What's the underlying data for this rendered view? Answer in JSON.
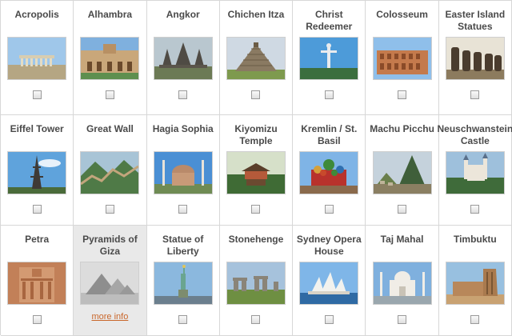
{
  "wonders": [
    {
      "name": "Acropolis",
      "thumb": "acropolis-photo"
    },
    {
      "name": "Alhambra",
      "thumb": "alhambra-photo"
    },
    {
      "name": "Angkor",
      "thumb": "angkor-photo"
    },
    {
      "name": "Chichen Itza",
      "thumb": "chichen-itza-photo"
    },
    {
      "name": "Christ Redeemer",
      "thumb": "christ-redeemer-photo"
    },
    {
      "name": "Colosseum",
      "thumb": "colosseum-photo"
    },
    {
      "name": "Easter Island Statues",
      "thumb": "easter-island-photo"
    },
    {
      "name": "Eiffel Tower",
      "thumb": "eiffel-tower-photo"
    },
    {
      "name": "Great Wall",
      "thumb": "great-wall-photo"
    },
    {
      "name": "Hagia Sophia",
      "thumb": "hagia-sophia-photo"
    },
    {
      "name": "Kiyomizu Temple",
      "thumb": "kiyomizu-photo"
    },
    {
      "name": "Kremlin / St. Basil",
      "thumb": "kremlin-photo"
    },
    {
      "name": "Machu Picchu",
      "thumb": "machu-picchu-photo"
    },
    {
      "name": "Neuschwanstein Castle",
      "thumb": "neuschwanstein-photo"
    },
    {
      "name": "Petra",
      "thumb": "petra-photo"
    },
    {
      "name": "Pyramids of Giza",
      "thumb": "pyramids-photo",
      "highlighted": true,
      "link": "more info"
    },
    {
      "name": "Statue of Liberty",
      "thumb": "statue-of-liberty-photo"
    },
    {
      "name": "Stonehenge",
      "thumb": "stonehenge-photo"
    },
    {
      "name": "Sydney Opera House",
      "thumb": "sydney-opera-photo"
    },
    {
      "name": "Taj Mahal",
      "thumb": "taj-mahal-photo"
    },
    {
      "name": "Timbuktu",
      "thumb": "timbuktu-photo"
    }
  ],
  "colors": {
    "label_text": "#4a4a4a",
    "grid_line": "#d7d7d7",
    "highlight_bg": "#e9e9e9",
    "link": "#c9672b"
  }
}
